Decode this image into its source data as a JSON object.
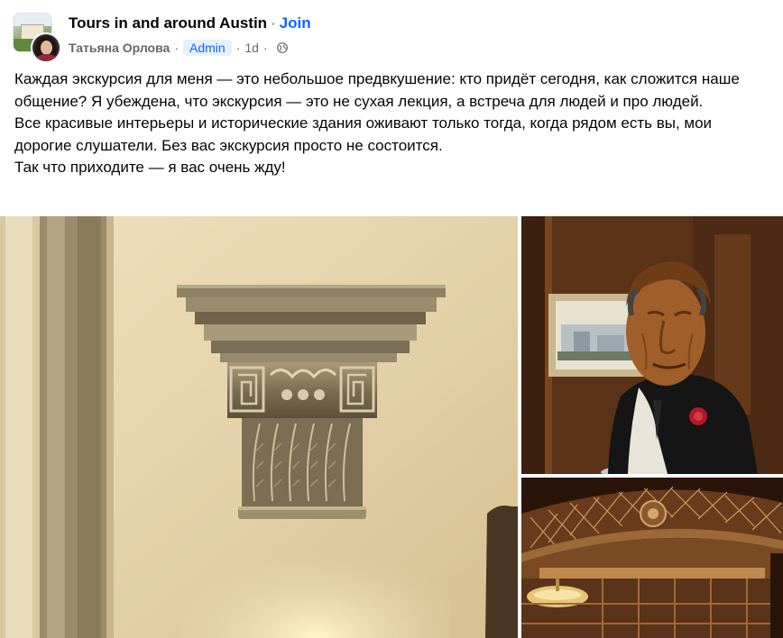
{
  "post": {
    "group_name": "Tours in and around Austin",
    "separator": "·",
    "join_label": "Join",
    "author": "Татьяна Орлова",
    "role_badge": "Admin",
    "time": "1d",
    "privacy_icon": "globe-icon"
  },
  "body": {
    "paragraphs": [
      "Каждая экскурсия для меня — это небольшое предвкушение: кто придёт сегодня, как сложится наше общение? Я убеждена, что экскурсия — это не сухая лекция, а встреча для людей и про людей.",
      "Все красивые интерьеры и исторические здания оживают только тогда, когда рядом есть вы, мои дорогие слушатели. Без вас экскурсия просто не состоится.",
      "Так что приходите — я вас очень жду!"
    ]
  },
  "photos": {
    "items": [
      {
        "name": "column-capital-photo"
      },
      {
        "name": "carved-wooden-figure-photo"
      },
      {
        "name": "ornate-archway-photo"
      }
    ]
  },
  "colors": {
    "link": "#0866ff",
    "secondary_text": "#65676b",
    "badge_bg": "#e7f0fe"
  }
}
